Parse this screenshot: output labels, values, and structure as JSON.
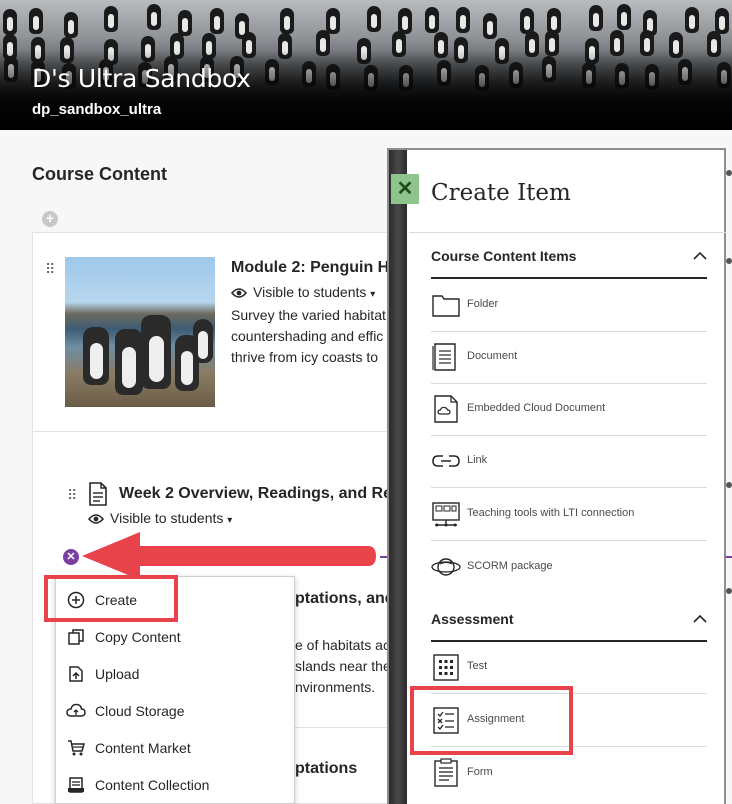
{
  "course": {
    "title": "D's Ultra Sandbox",
    "id": "dp_sandbox_ultra"
  },
  "main": {
    "section_title": "Course Content",
    "module": {
      "title": "Module 2: Penguin H",
      "visibility": "Visible to students",
      "description_lines": [
        "Survey the varied habitat",
        "countershading and effic",
        "thrive from icy coasts to"
      ]
    },
    "week": {
      "title": "Week 2 Overview, Readings, and Re",
      "visibility": "Visible to students"
    },
    "behind": {
      "heading_1": "ptations, and",
      "line_1": "e of habitats ac",
      "line_2": "slands near the",
      "line_3": "nvironments.",
      "heading_2": "ptations"
    }
  },
  "menu": {
    "items": [
      {
        "label": "Create",
        "icon": "plus-circle-icon"
      },
      {
        "label": "Copy Content",
        "icon": "copy-icon"
      },
      {
        "label": "Upload",
        "icon": "upload-icon"
      },
      {
        "label": "Cloud Storage",
        "icon": "cloud-icon"
      },
      {
        "label": "Content Market",
        "icon": "cart-icon"
      },
      {
        "label": "Content Collection",
        "icon": "collection-icon"
      }
    ]
  },
  "panel": {
    "close_label": "✕",
    "title": "Create Item",
    "groups": [
      {
        "heading": "Course Content Items",
        "items": [
          {
            "label": "Folder",
            "icon": "folder-icon"
          },
          {
            "label": "Document",
            "icon": "document-icon"
          },
          {
            "label": "Embedded Cloud Document",
            "icon": "cloud-document-icon"
          },
          {
            "label": "Link",
            "icon": "link-icon"
          },
          {
            "label": "Teaching tools with LTI connection",
            "icon": "lti-icon"
          },
          {
            "label": "SCORM package",
            "icon": "scorm-icon"
          }
        ]
      },
      {
        "heading": "Assessment",
        "items": [
          {
            "label": "Test",
            "icon": "test-icon"
          },
          {
            "label": "Assignment",
            "icon": "assignment-icon"
          },
          {
            "label": "Form",
            "icon": "form-icon"
          }
        ]
      }
    ]
  },
  "colors": {
    "highlight": "#e8434b",
    "accent_purple": "#7b3fa0",
    "close_green": "#8fc58c"
  }
}
